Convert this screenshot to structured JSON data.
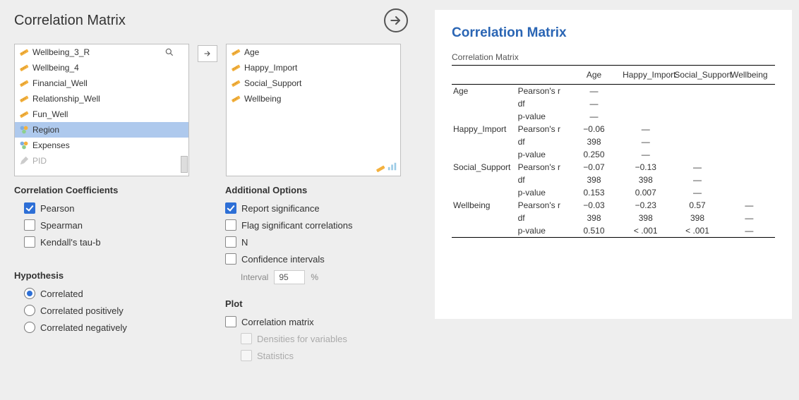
{
  "header": {
    "title": "Correlation Matrix"
  },
  "source_vars": [
    {
      "name": "Wellbeing_3_R",
      "type": "scale"
    },
    {
      "name": "Wellbeing_4",
      "type": "scale"
    },
    {
      "name": "Financial_Well",
      "type": "scale"
    },
    {
      "name": "Relationship_Well",
      "type": "scale"
    },
    {
      "name": "Fun_Well",
      "type": "scale"
    },
    {
      "name": "Region",
      "type": "nominal",
      "selected": true
    },
    {
      "name": "Expenses",
      "type": "nominal"
    },
    {
      "name": "PID",
      "type": "id",
      "disabled": true
    }
  ],
  "dest_vars": [
    {
      "name": "Age",
      "type": "scale"
    },
    {
      "name": "Happy_Import",
      "type": "scale"
    },
    {
      "name": "Social_Support",
      "type": "scale"
    },
    {
      "name": "Wellbeing",
      "type": "scale"
    }
  ],
  "coef": {
    "title": "Correlation Coefficients",
    "pearson": "Pearson",
    "spearman": "Spearman",
    "kendall": "Kendall's tau-b"
  },
  "addl": {
    "title": "Additional Options",
    "report_sig": "Report significance",
    "flag": "Flag significant correlations",
    "n": "N",
    "ci": "Confidence intervals",
    "interval_label": "Interval",
    "interval_value": "95",
    "interval_suffix": "%"
  },
  "hyp": {
    "title": "Hypothesis",
    "correlated": "Correlated",
    "pos": "Correlated positively",
    "neg": "Correlated negatively"
  },
  "plot": {
    "title": "Plot",
    "matrix": "Correlation matrix",
    "densities": "Densities for variables",
    "stats": "Statistics"
  },
  "results": {
    "title": "Correlation Matrix",
    "subtitle": "Correlation Matrix",
    "col_headers": [
      "Age",
      "Happy_Import",
      "Social_Support",
      "Wellbeing"
    ],
    "stat_labels": [
      "Pearson's r",
      "df",
      "p-value"
    ],
    "rows": [
      {
        "var": "Age",
        "cells": [
          [
            "—",
            "",
            "",
            ""
          ],
          [
            "—",
            "",
            "",
            ""
          ],
          [
            "—",
            "",
            "",
            ""
          ]
        ]
      },
      {
        "var": "Happy_Import",
        "cells": [
          [
            "−0.06",
            "—",
            "",
            ""
          ],
          [
            "398",
            "—",
            "",
            ""
          ],
          [
            "0.250",
            "—",
            "",
            ""
          ]
        ]
      },
      {
        "var": "Social_Support",
        "cells": [
          [
            "−0.07",
            "−0.13",
            "—",
            ""
          ],
          [
            "398",
            "398",
            "—",
            ""
          ],
          [
            "0.153",
            "0.007",
            "—",
            ""
          ]
        ]
      },
      {
        "var": "Wellbeing",
        "cells": [
          [
            "−0.03",
            "−0.23",
            "0.57",
            "—"
          ],
          [
            "398",
            "398",
            "398",
            "—"
          ],
          [
            "0.510",
            "< .001",
            "< .001",
            "—"
          ]
        ]
      }
    ]
  }
}
